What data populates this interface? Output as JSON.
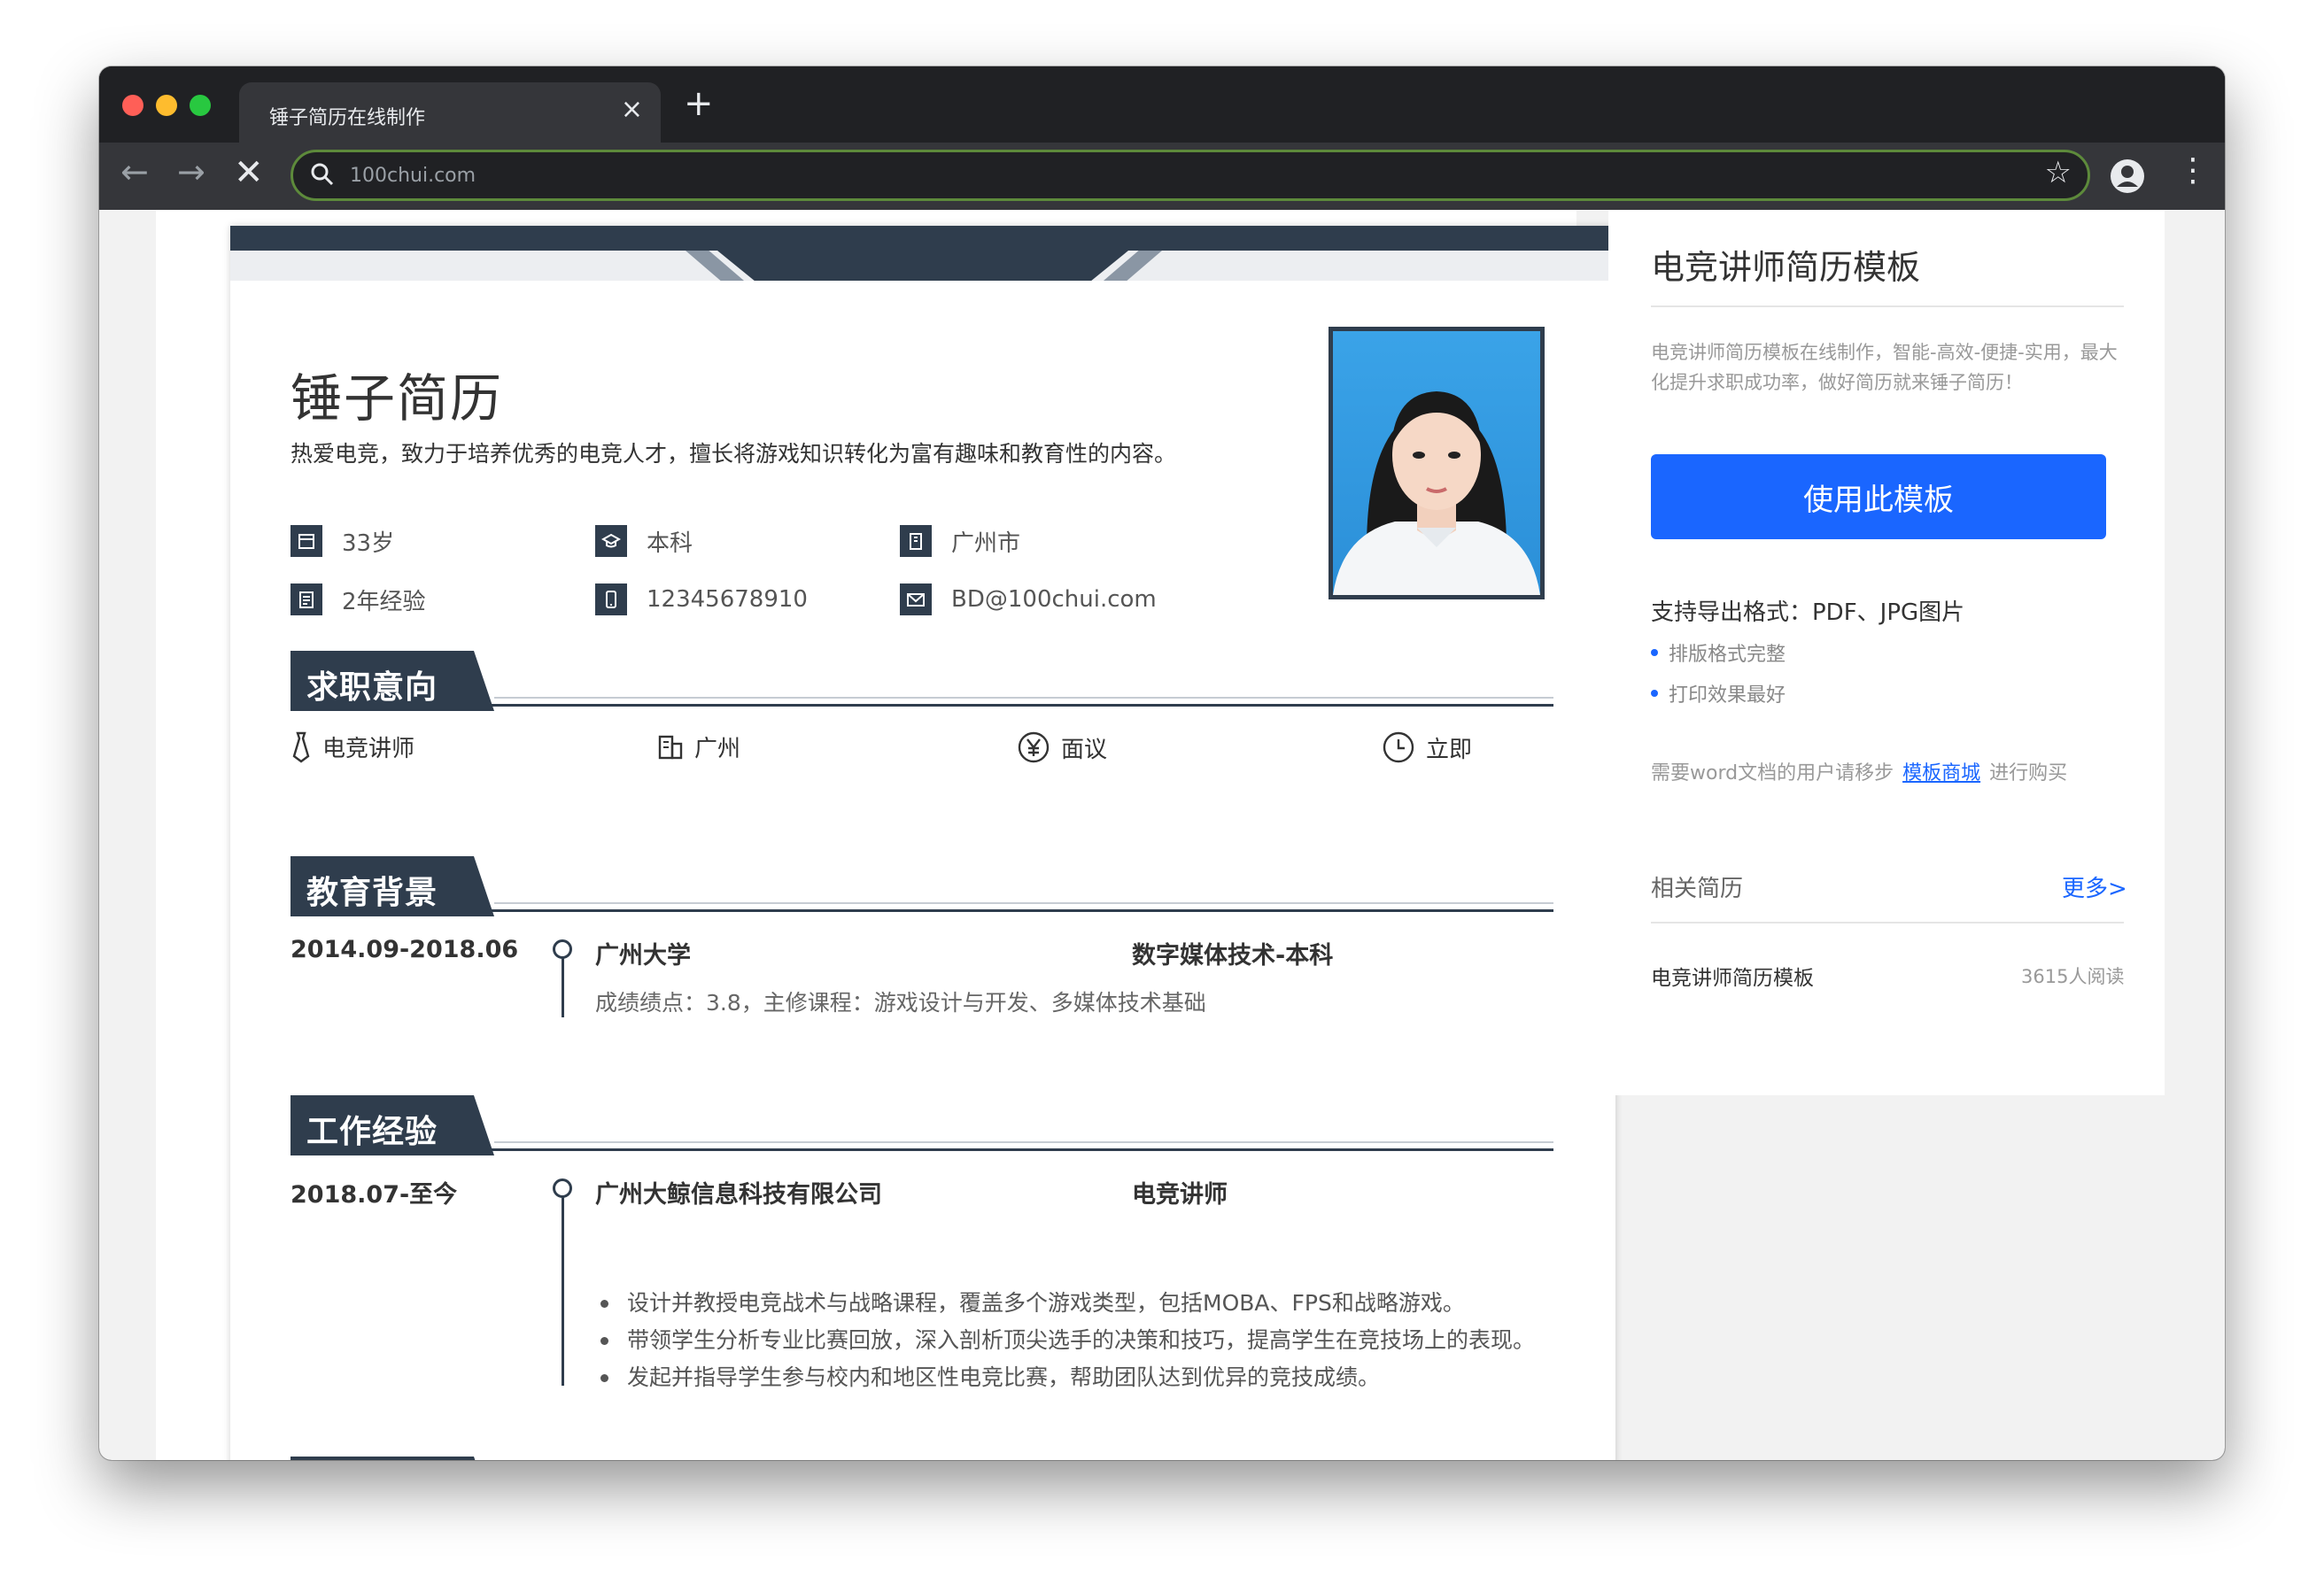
{
  "browser": {
    "tab_title": "锤子简历在线制作",
    "url": "100chui.com"
  },
  "resume": {
    "name": "锤子简历",
    "intro": "热爱电竞，致力于培养优秀的电竞人才，擅长将游戏知识转化为富有趣味和教育性的内容。",
    "info": {
      "age": "33岁",
      "degree": "本科",
      "city": "广州市",
      "experience": "2年经验",
      "phone": "12345678910",
      "email": "BD@100chui.com"
    },
    "sections": {
      "objective": "求职意向",
      "education": "教育背景",
      "work": "工作经验"
    },
    "objective": {
      "position": "电竞讲师",
      "city": "广州",
      "salary": "面议",
      "availability": "立即"
    },
    "education": {
      "date": "2014.09-2018.06",
      "school": "广州大学",
      "major": "数字媒体技术-本科",
      "desc": "成绩绩点：3.8，主修课程：游戏设计与开发、多媒体技术基础"
    },
    "work": {
      "date": "2018.07-至今",
      "company": "广州大鲸信息科技有限公司",
      "role": "电竞讲师",
      "bullets": [
        "设计并教授电竞战术与战略课程，覆盖多个游戏类型，包括MOBA、FPS和战略游戏。",
        "带领学生分析专业比赛回放，深入剖析顶尖选手的决策和技巧，提高学生在竞技场上的表现。",
        "发起并指导学生参与校内和地区性电竞比赛，帮助团队达到优异的竞技成绩。"
      ]
    }
  },
  "sidebar": {
    "title": "电竞讲师简历模板",
    "desc": "电竞讲师简历模板在线制作，智能-高效-便捷-实用，最大化提升求职成功率，做好简历就来锤子简历！",
    "button": "使用此模板",
    "formats": "支持导出格式：PDF、JPG图片",
    "feature1": "排版格式完整",
    "feature2": "打印效果最好",
    "word_prefix": "需要word文档的用户请移步",
    "word_link": "模板商城",
    "word_suffix": "进行购买",
    "related": "相关简历",
    "more": "更多>",
    "related_item": "电竞讲师简历模板",
    "related_reads": "3615人阅读"
  },
  "colors": {
    "accent": "#2f3d4d",
    "button": "#1a66ff"
  }
}
